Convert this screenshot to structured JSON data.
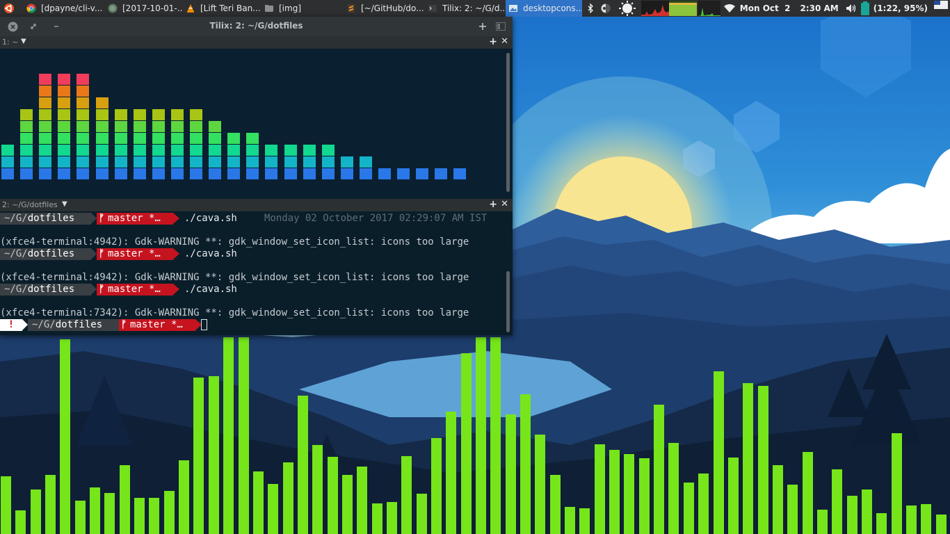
{
  "panel": {
    "windows": [
      {
        "label": "[dpayne/cli-v...",
        "icon": "chrome-icon"
      },
      {
        "label": "[2017-10-01-...",
        "icon": "app-globe-icon"
      },
      {
        "label": "[Lift Teri Ban...",
        "icon": "vlc-icon"
      },
      {
        "label": "[img]",
        "icon": "folder-icon"
      },
      {
        "label": "[~/GitHub/do...",
        "icon": "sublime-icon"
      },
      {
        "label": "Tilix: 2: ~/G/d...",
        "icon": "terminal-icon"
      },
      {
        "label": "desktopcons...",
        "icon": "image-viewer-icon",
        "active": true
      }
    ],
    "clock_date": "Mon Oct  2",
    "clock_time": "2:30 AM",
    "battery": "(1:22, 95%)"
  },
  "tilix": {
    "title": "Tilix: 2: ~/G/dotfiles",
    "pane1_title": "1: ~",
    "pane2_title": "2: ~/G/dotfiles",
    "prompt_path_prefix": "~/G/",
    "prompt_path_dir": "dotfiles",
    "prompt_branch": "master *…",
    "git_symbol": "ᚠ",
    "error_symbol": "!",
    "lines": [
      {
        "kind": "prompt",
        "cmd": "./cava.sh",
        "timestamp": "Monday 02 October 2017 02:29:07 AM IST"
      },
      {
        "kind": "blank"
      },
      {
        "kind": "warning",
        "text": "(xfce4-terminal:4942): Gdk-WARNING **: gdk_window_set_icon_list: icons too large"
      },
      {
        "kind": "prompt",
        "cmd": "./cava.sh"
      },
      {
        "kind": "blank"
      },
      {
        "kind": "warning",
        "text": "(xfce4-terminal:4942): Gdk-WARNING **: gdk_window_set_icon_list: icons too large"
      },
      {
        "kind": "prompt",
        "cmd": "./cava.sh"
      },
      {
        "kind": "blank"
      },
      {
        "kind": "warning",
        "text": "(xfce4-terminal:7342): Gdk-WARNING **: gdk_window_set_icon_list: icons too large"
      },
      {
        "kind": "prompt-error",
        "cmd": ""
      }
    ]
  },
  "cava_terminal": {
    "levels": [
      3,
      6,
      9,
      9,
      9,
      7,
      6,
      6,
      6,
      6,
      6,
      5,
      4,
      4,
      3,
      3,
      3,
      3,
      2,
      2,
      1,
      1,
      1,
      1,
      1
    ],
    "colors": [
      "#2a78e8",
      "#14b4c8",
      "#12d890",
      "#34e060",
      "#5ed640",
      "#a8c414",
      "#d8a010",
      "#e87818",
      "#f23c5c"
    ]
  },
  "cava_desktop": {
    "color": "#76e51a",
    "levels": [
      83,
      34,
      64,
      85,
      280,
      48,
      67,
      59,
      99,
      52,
      52,
      62,
      106,
      225,
      227,
      283,
      283,
      90,
      72,
      103,
      199,
      128,
      111,
      85,
      97,
      44,
      46,
      112,
      58,
      138,
      176,
      260,
      283,
      283,
      172,
      201,
      143,
      85,
      39,
      37,
      129,
      121,
      115,
      109,
      186,
      131,
      74,
      87,
      234,
      110,
      217,
      213,
      99,
      71,
      118,
      35,
      93,
      55,
      64,
      30,
      145,
      41,
      43,
      28
    ]
  }
}
